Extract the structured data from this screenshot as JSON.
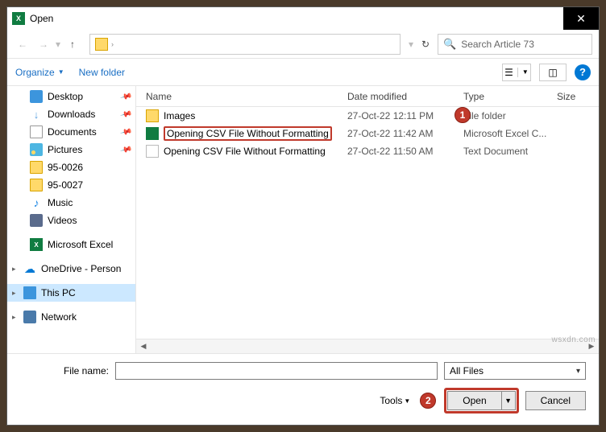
{
  "title": "Open",
  "search_placeholder": "Search Article 73",
  "toolbar": {
    "organize": "Organize",
    "new_folder": "New folder"
  },
  "sidebar": {
    "items": [
      {
        "label": "Desktop"
      },
      {
        "label": "Downloads"
      },
      {
        "label": "Documents"
      },
      {
        "label": "Pictures"
      },
      {
        "label": "95-0026"
      },
      {
        "label": "95-0027"
      },
      {
        "label": "Music"
      },
      {
        "label": "Videos"
      },
      {
        "label": "Microsoft Excel"
      },
      {
        "label": "OneDrive - Person"
      },
      {
        "label": "This PC"
      },
      {
        "label": "Network"
      }
    ]
  },
  "headers": {
    "name": "Name",
    "date": "Date modified",
    "type": "Type",
    "size": "Size"
  },
  "files": [
    {
      "name": "Images",
      "date": "27-Oct-22 12:11 PM",
      "type": "File folder"
    },
    {
      "name": "Opening CSV File Without Formatting",
      "date": "27-Oct-22 11:42 AM",
      "type": "Microsoft Excel C..."
    },
    {
      "name": "Opening CSV File Without Formatting",
      "date": "27-Oct-22 11:50 AM",
      "type": "Text Document"
    }
  ],
  "footer": {
    "filename_label": "File name:",
    "filename_value": "",
    "filter": "All Files",
    "tools": "Tools",
    "open": "Open",
    "cancel": "Cancel"
  },
  "badges": {
    "b1": "1",
    "b2": "2"
  },
  "watermark": "wsxdn.com"
}
